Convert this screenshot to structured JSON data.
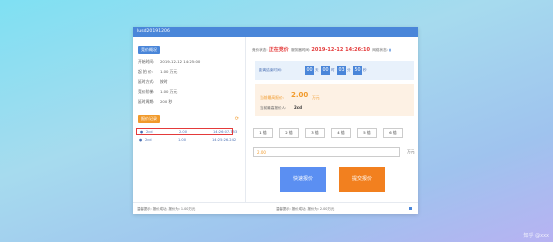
{
  "window_title": "lusd20191206",
  "left": {
    "overview_label": "竞价概况",
    "info": [
      {
        "k": "开始时间:",
        "v": "2019-12-12 14:25:00"
      },
      {
        "k": "起 拍 价:",
        "v": "1.00 万元"
      },
      {
        "k": "延时方式:",
        "v": "按时"
      },
      {
        "k": "竞价阶梯:",
        "v": "1.00 万元"
      },
      {
        "k": "延时周期:",
        "v": "200 秒"
      }
    ],
    "record_label": "报价记录",
    "records": [
      {
        "user": "2cd",
        "price": "2.00",
        "time": "14:26:07.753"
      },
      {
        "user": "2cd",
        "price": "1.00",
        "time": "14:25:26.242"
      }
    ]
  },
  "right": {
    "status_label": "竞价状态:",
    "status_value": "正在竞价",
    "server_time_label": "服务器时间:",
    "server_time": "2019-12-12 14:26:10",
    "network_label": "网络状态:",
    "countdown_label": "距离结束时间:",
    "countdown": {
      "d": "00",
      "d_unit": "天",
      "h": "00",
      "h_unit": "时",
      "m": "03",
      "m_unit": "分",
      "s": "50",
      "s_unit": "秒"
    },
    "current_price_label": "当前最高报价:",
    "current_price": "2.00",
    "current_price_unit": "万元",
    "top_bidder_label": "当前最高报价人:",
    "top_bidder": "2cd",
    "multiples": [
      "1 倍",
      "2 倍",
      "3 倍",
      "4 倍",
      "5 倍",
      "6 倍"
    ],
    "input_value": "2.00",
    "input_unit": "万元",
    "quick_bid_label": "快速报价",
    "submit_bid_label": "提交报价"
  },
  "status_bar": {
    "left": "温馨提示: 报价成功, 报价为: 1.00万元",
    "right": "温馨提示: 报价成功, 报价为: 2.00万元"
  },
  "watermark": "知乎 @xxx",
  "colors": {
    "primary": "#4a86d9",
    "orange": "#f19a2b",
    "red": "#e43a3a"
  }
}
